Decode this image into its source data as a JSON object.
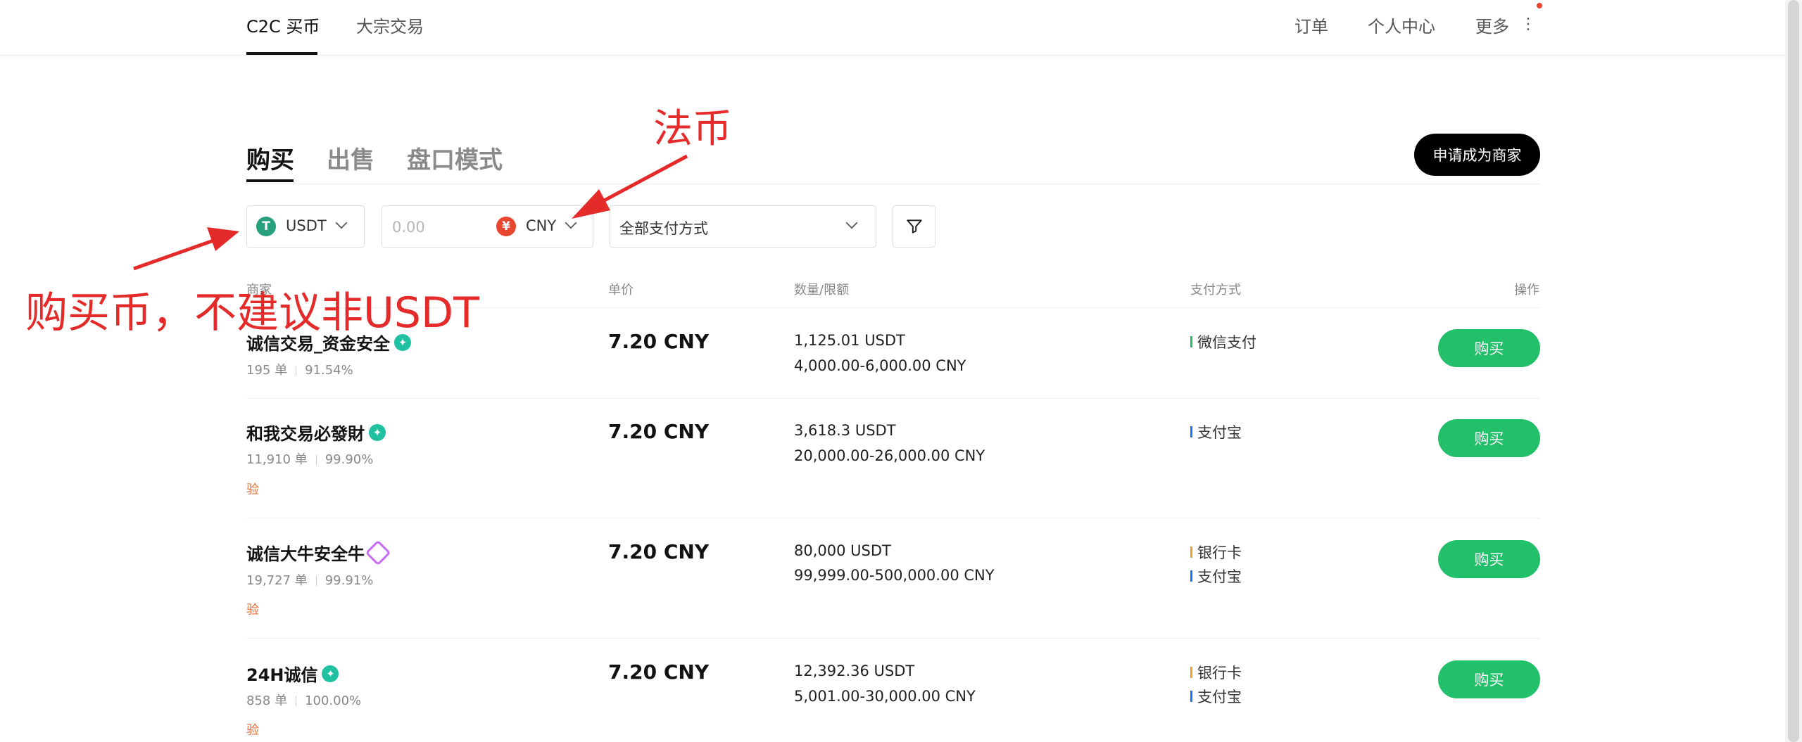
{
  "nav": {
    "tabs": [
      {
        "label": "C2C 买币",
        "active": true
      },
      {
        "label": "大宗交易",
        "active": false
      }
    ],
    "right": [
      {
        "label": "订单"
      },
      {
        "label": "个人中心"
      },
      {
        "label": "更多"
      }
    ],
    "more_icon": "vertical-dots-icon",
    "notification_dot_color": "#e8462e"
  },
  "trade_tabs": [
    {
      "label": "购买",
      "active": true
    },
    {
      "label": "出售",
      "active": false
    },
    {
      "label": "盘口模式",
      "active": false
    }
  ],
  "merchant_button": "申请成为商家",
  "filters": {
    "coin": {
      "icon": "tether-icon",
      "icon_text": "T",
      "icon_color": "#26a17b",
      "value": "USDT"
    },
    "amount": {
      "placeholder": "0.00",
      "value": ""
    },
    "fiat": {
      "icon": "yuan-icon",
      "icon_text": "¥",
      "icon_color": "#e8462e",
      "value": "CNY"
    },
    "payment": {
      "value": "全部支付方式"
    },
    "filter_icon": "funnel-icon"
  },
  "table": {
    "headers": {
      "merchant": "商家",
      "price": "单价",
      "quantity": "数量/限额",
      "payment": "支付方式",
      "action": "操作"
    },
    "rows": [
      {
        "name": "诚信交易_资金安全",
        "badge": "green",
        "orders": "195 单",
        "completion": "91.54%",
        "tag": "",
        "price": "7.20 CNY",
        "amount": "1,125.01 USDT",
        "limit": "4,000.00-6,000.00 CNY",
        "payments": [
          {
            "label": "微信支付",
            "color": "#22c06a"
          }
        ],
        "button": "购买"
      },
      {
        "name": "和我交易必發財",
        "badge": "green",
        "orders": "11,910 单",
        "completion": "99.90%",
        "tag": "验",
        "price": "7.20 CNY",
        "amount": "3,618.3 USDT",
        "limit": "20,000.00-26,000.00 CNY",
        "payments": [
          {
            "label": "支付宝",
            "color": "#1677ff"
          }
        ],
        "button": "购买"
      },
      {
        "name": "诚信大牛安全牛",
        "badge": "purple",
        "orders": "19,727 单",
        "completion": "99.91%",
        "tag": "验",
        "price": "7.20 CNY",
        "amount": "80,000 USDT",
        "limit": "99,999.00-500,000.00 CNY",
        "payments": [
          {
            "label": "银行卡",
            "color": "#f0a030"
          },
          {
            "label": "支付宝",
            "color": "#1677ff"
          }
        ],
        "button": "购买"
      },
      {
        "name": "24H诚信",
        "badge": "green",
        "orders": "858 单",
        "completion": "100.00%",
        "tag": "验",
        "price": "7.20 CNY",
        "amount": "12,392.36 USDT",
        "limit": "5,001.00-30,000.00 CNY",
        "payments": [
          {
            "label": "银行卡",
            "color": "#f0a030"
          },
          {
            "label": "支付宝",
            "color": "#1677ff"
          }
        ],
        "button": "购买"
      }
    ]
  },
  "annotations": {
    "fiat_note": "法币",
    "coin_note": "购买币，不建议非USDT",
    "color": "#e52a2a"
  }
}
